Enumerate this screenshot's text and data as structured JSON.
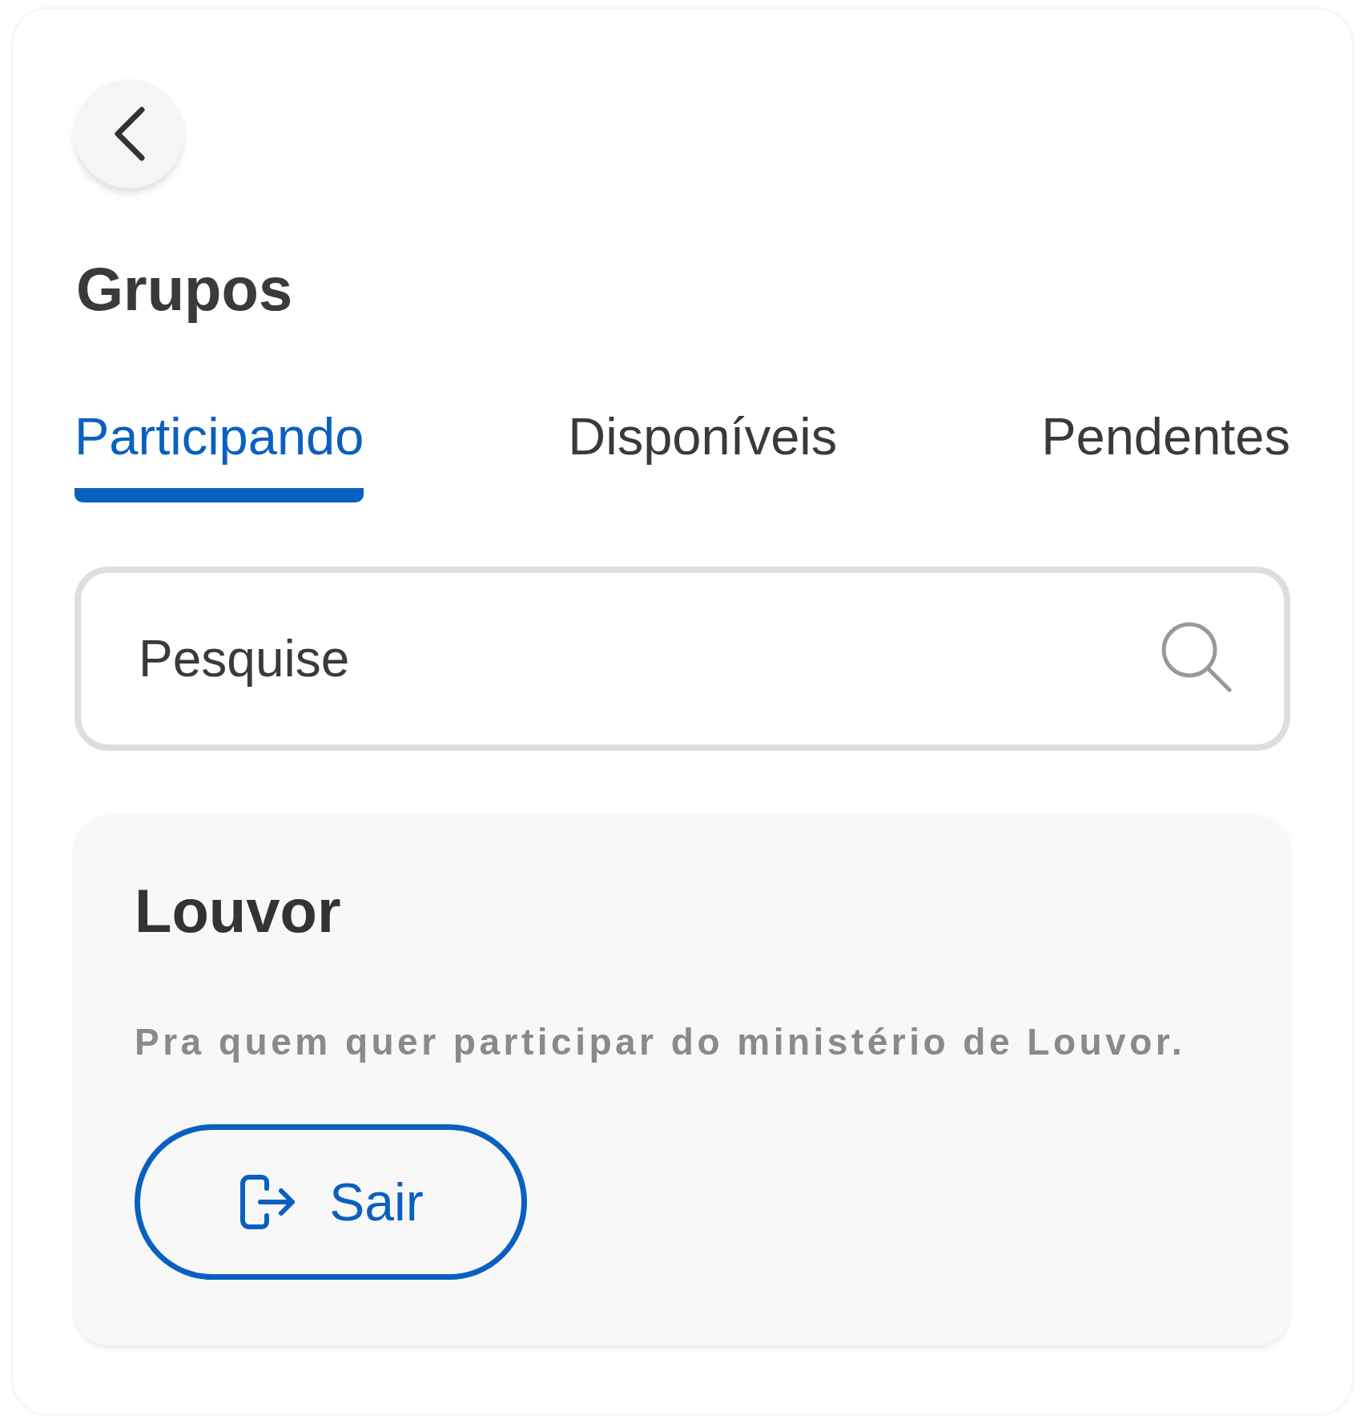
{
  "title": "Grupos",
  "tabs": [
    {
      "label": "Participando",
      "selected": true
    },
    {
      "label": "Disponíveis",
      "selected": false
    },
    {
      "label": "Pendentes",
      "selected": false
    }
  ],
  "search": {
    "placeholder": "Pesquise"
  },
  "groups": [
    {
      "name": "Louvor",
      "description": "Pra quem quer participar do ministério de Louvor.",
      "action": "Sair"
    }
  ]
}
